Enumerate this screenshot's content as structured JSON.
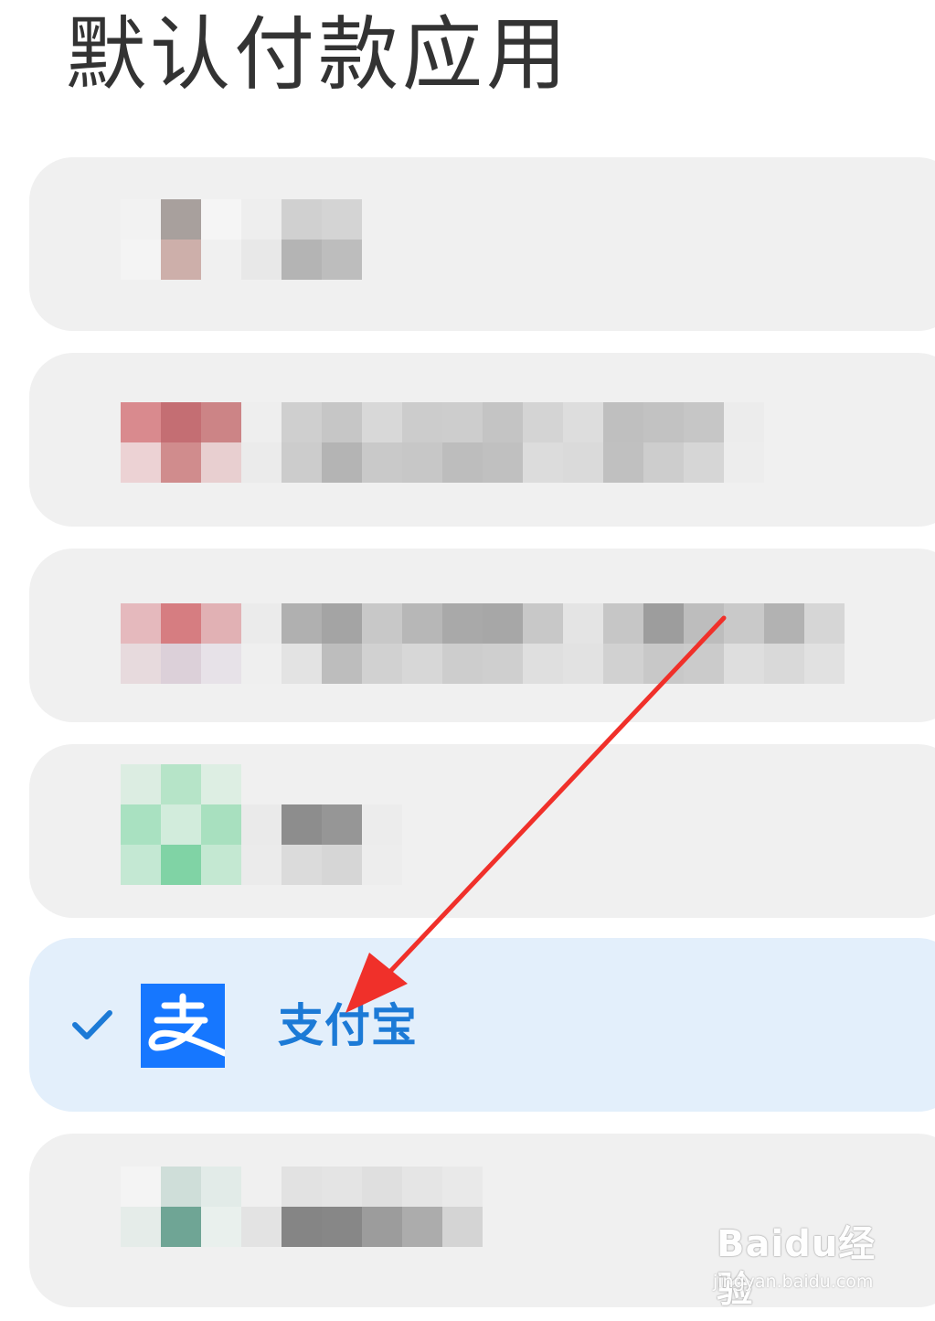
{
  "page": {
    "title": "默认付款应用"
  },
  "apps": [
    {
      "name": "",
      "selected": false,
      "obscured": true
    },
    {
      "name": "",
      "selected": false,
      "obscured": true
    },
    {
      "name": "",
      "selected": false,
      "obscured": true
    },
    {
      "name": "",
      "selected": false,
      "obscured": true
    },
    {
      "name": "支付宝",
      "selected": true,
      "obscured": false,
      "icon": "alipay-logo-icon"
    },
    {
      "name": "",
      "selected": false,
      "obscured": true
    }
  ],
  "colors": {
    "card_background": "#f0f0f0",
    "selected_card_background": "#e3effb",
    "accent_blue": "#1c7ad6",
    "alipay_blue": "#1677ff",
    "annotation_red": "#f0302a"
  },
  "icons": {
    "selected_indicator": "check-icon",
    "annotation": "red-arrow-icon"
  },
  "watermark": {
    "brand": "Baidu经验",
    "url": "jingyan.baidu.com"
  }
}
